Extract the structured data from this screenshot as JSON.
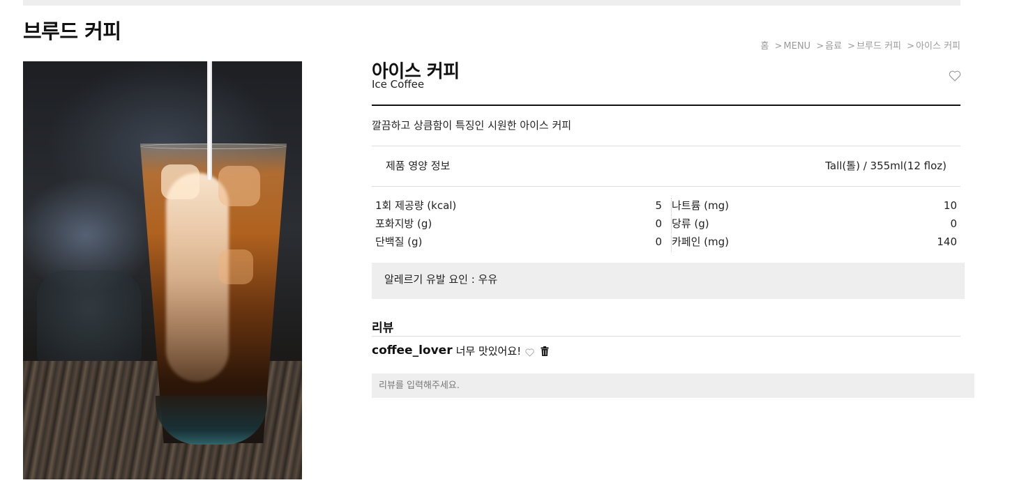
{
  "page": {
    "category_title": "브루드 커피"
  },
  "breadcrumb": {
    "items": [
      {
        "label": "홈"
      },
      {
        "label": "MENU"
      },
      {
        "label": "음료"
      },
      {
        "label": "브루드 커피"
      },
      {
        "label": "아이스 커피"
      }
    ],
    "separator": ">"
  },
  "product": {
    "name_ko": "아이스 커피",
    "name_en": "Ice Coffee",
    "description": "깔끔하고 상큼함이 특징인 시원한 아이스 커피",
    "favorite_icon": "heart-outline-icon",
    "image_subject": "iced coffee with milk being poured"
  },
  "nutrition": {
    "title": "제품 영양 정보",
    "serving_size": "Tall(톨) / 355ml(12 floz)",
    "left": [
      {
        "label": "1회 제공량 (kcal)",
        "value": "5"
      },
      {
        "label": "포화지방 (g)",
        "value": "0"
      },
      {
        "label": "단백질 (g)",
        "value": "0"
      }
    ],
    "right": [
      {
        "label": "나트륨 (mg)",
        "value": "10"
      },
      {
        "label": "당류 (g)",
        "value": "0"
      },
      {
        "label": "카페인 (mg)",
        "value": "140"
      }
    ]
  },
  "allergy": {
    "text": "알레르기 유발 요인 : 우유"
  },
  "reviews": {
    "heading": "리뷰",
    "items": [
      {
        "user": "coffee_lover",
        "text": "너무 맛있어요!",
        "like_icon": "heart-outline-icon",
        "delete_icon": "trash-icon"
      }
    ],
    "input": {
      "placeholder": "리뷰를 입력해주세요.",
      "value": ""
    }
  },
  "colors": {
    "panel_bg": "#eeeeee",
    "breadcrumb_text": "#9a9a9a",
    "text": "#111111"
  }
}
